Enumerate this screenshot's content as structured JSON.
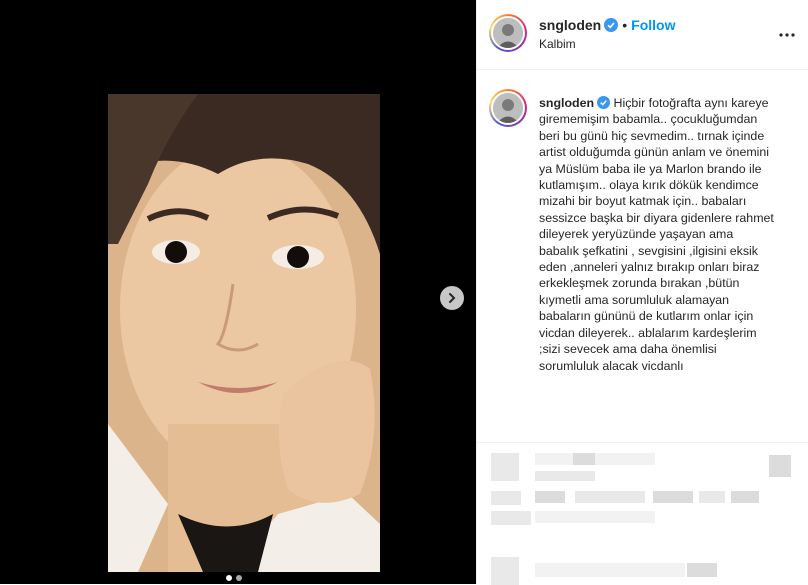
{
  "post": {
    "media": {
      "next_icon": "chevron-right-icon",
      "carousel_count": 2,
      "carousel_active_index": 0
    },
    "header": {
      "username": "sngloden",
      "verified_icon": "verified-badge-icon",
      "separator": "•",
      "follow_label": "Follow",
      "location": "Kalbim",
      "more_icon": "more-options-icon"
    },
    "caption": {
      "username": "sngloden",
      "text": "Hiçbir fotoğrafta aynı kareye girememişim babamla.. çocukluğumdan beri bu günü hiç sevmedim.. tırnak içinde artist olduğumda günün anlam ve önemini ya Müslüm baba ile ya Marlon brando ile kutlamışım.. olaya kırık dökük kendimce mizahi bir boyut katmak için.. babaları sessizce başka bir diyara gidenlere rahmet dileyerek yeryüzünde yaşayan ama babalık şefkatini , sevgisini ,ilgisini eksik eden ,anneleri yalnız bırakıp onları biraz erkekleşmek zorunda bırakan ,bütün kıymetli ama sorumluluk alamayan babaların gününü de kutlarım onlar için vicdan dileyerek.. ablalarım kardeşlerim ;sizi sevecek ama daha önemlisi sorumluluk alacak vicdanlı"
    },
    "colors": {
      "link": "#0095f6",
      "text": "#262626",
      "verified": "#3897f0",
      "media_bg": "#000000"
    }
  }
}
